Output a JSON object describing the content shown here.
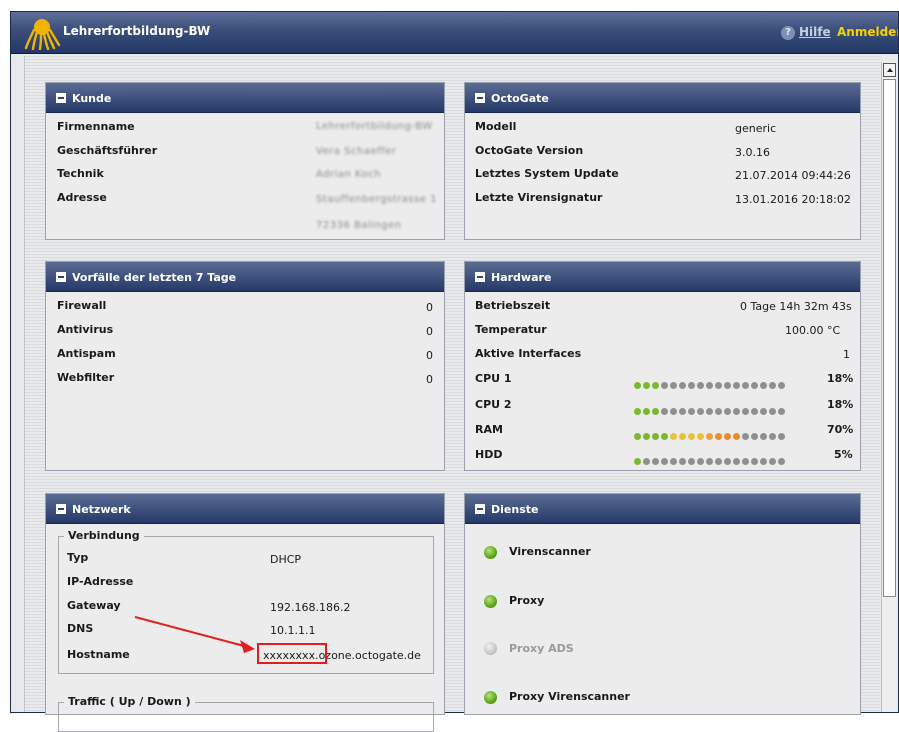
{
  "app": {
    "title": "Lehrerfortbildung-BW",
    "help_label": "Hilfe",
    "login_label": "Anmelden",
    "help_icon_glyph": "?"
  },
  "kunde": {
    "title": "Kunde",
    "rows": [
      {
        "label": "Firmenname",
        "value": "Lehrerfortbildung-BW"
      },
      {
        "label": "Geschäftsführer",
        "value": "Vera Schaeffer"
      },
      {
        "label": "Technik",
        "value": "Adrian Koch"
      },
      {
        "label": "Adresse",
        "value": "Stauffenbergstrasse 1"
      }
    ],
    "address_line2": "72336 Balingen"
  },
  "octogate": {
    "title": "OctoGate",
    "rows": [
      {
        "label": "Modell",
        "value": "generic"
      },
      {
        "label": "OctoGate Version",
        "value": "3.0.16"
      },
      {
        "label": "Letztes System Update",
        "value": "21.07.2014 09:44:26"
      },
      {
        "label": "Letzte Virensignatur",
        "value": "13.01.2016 20:18:02"
      }
    ]
  },
  "vorfaelle": {
    "title": "Vorfälle der letzten 7 Tage",
    "rows": [
      {
        "label": "Firewall",
        "value": "0"
      },
      {
        "label": "Antivirus",
        "value": "0"
      },
      {
        "label": "Antispam",
        "value": "0"
      },
      {
        "label": "Webfilter",
        "value": "0"
      }
    ]
  },
  "hardware": {
    "title": "Hardware",
    "rows": [
      {
        "label": "Betriebszeit",
        "value": "0 Tage 14h 32m 43s"
      },
      {
        "label": "Temperatur",
        "value": "100.00 °C"
      },
      {
        "label": "Aktive Interfaces",
        "value": "1"
      }
    ],
    "meters": [
      {
        "label": "CPU 1",
        "percent": "18%",
        "lit": 3,
        "colors": [
          "#7cb82f",
          "#7cb82f",
          "#7cb82f"
        ]
      },
      {
        "label": "CPU 2",
        "percent": "18%",
        "lit": 3,
        "colors": [
          "#7cb82f",
          "#7cb82f",
          "#7cb82f"
        ]
      },
      {
        "label": "RAM",
        "percent": "70%",
        "lit": 12,
        "colors": [
          "#7cb82f",
          "#7cb82f",
          "#7cb82f",
          "#7cb82f",
          "#e8c23a",
          "#e8c23a",
          "#e8c23a",
          "#e8c23a",
          "#e8a23a",
          "#ec8a2e",
          "#ec8a2e",
          "#ec8a2e"
        ]
      },
      {
        "label": "HDD",
        "percent": "5%",
        "lit": 1,
        "colors": [
          "#7cb82f"
        ]
      }
    ],
    "dot_count": 17,
    "dot_off_color": "#8f8f8f"
  },
  "netzwerk": {
    "title": "Netzwerk",
    "verbindung_legend": "Verbindung",
    "rows": [
      {
        "label": "Typ",
        "value": "DHCP"
      },
      {
        "label": "IP-Adresse",
        "value": ""
      },
      {
        "label": "Gateway",
        "value": "192.168.186.2"
      },
      {
        "label": "DNS",
        "value": "10.1.1.1"
      },
      {
        "label": "Hostname",
        "value": "xxxxxxxx.ozone.octogate.de"
      }
    ],
    "traffic_legend": "Traffic ( Up / Down )"
  },
  "dienste": {
    "title": "Dienste",
    "services": [
      {
        "label": "Virenscanner",
        "status": "on"
      },
      {
        "label": "Proxy",
        "status": "on"
      },
      {
        "label": "Proxy ADS",
        "status": "off"
      },
      {
        "label": "Proxy Virenscanner",
        "status": "on"
      }
    ]
  },
  "colors": {
    "header_top": "#5b6c94",
    "header_bottom": "#253968",
    "login": "#f5d300",
    "annotation": "#e02020"
  }
}
